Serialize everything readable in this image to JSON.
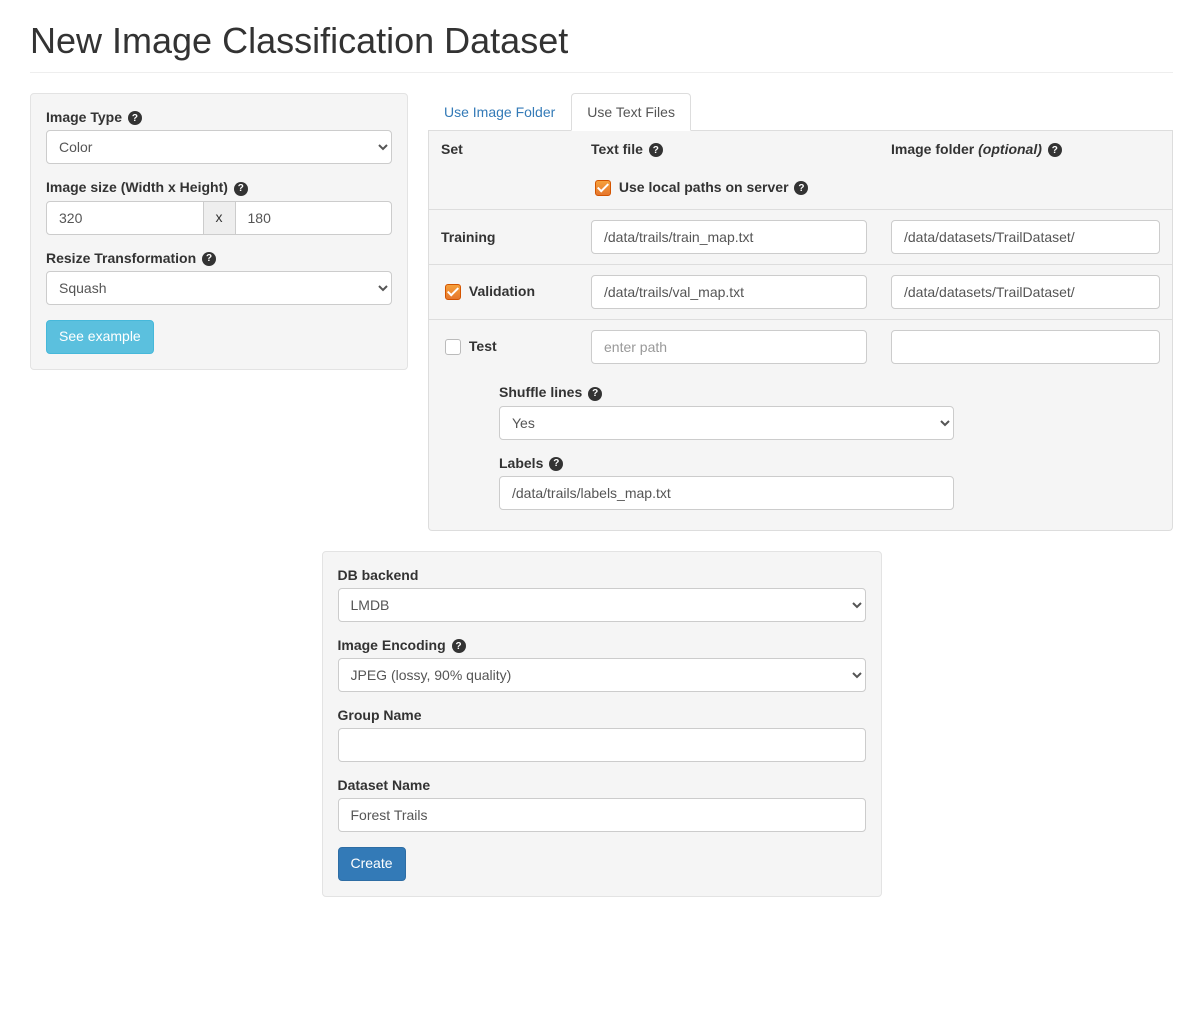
{
  "page": {
    "title": "New Image Classification Dataset"
  },
  "left": {
    "imageTypeLabel": "Image Type",
    "imageTypeValue": "Color",
    "imageSizeLabel": "Image size (Width x Height)",
    "width": "320",
    "height": "180",
    "xLabel": "x",
    "resizeLabel": "Resize Transformation",
    "resizeValue": "Squash",
    "seeExample": "See example"
  },
  "tabs": {
    "folder": "Use Image Folder",
    "text": "Use Text Files"
  },
  "setTable": {
    "colSet": "Set",
    "colTextFile": "Text file",
    "colImageFolder": "Image folder",
    "colOptional": "(optional)",
    "useLocal": "Use local paths on server",
    "training": {
      "label": "Training",
      "textfile": "/data/trails/train_map.txt",
      "folder": "/data/datasets/TrailDataset/"
    },
    "validation": {
      "label": "Validation",
      "textfile": "/data/trails/val_map.txt",
      "folder": "/data/datasets/TrailDataset/"
    },
    "test": {
      "label": "Test",
      "textfile": "",
      "placeholder": "enter path",
      "folder": ""
    },
    "shuffleLabel": "Shuffle lines",
    "shuffleValue": "Yes",
    "labelsLabel": "Labels",
    "labelsValue": "/data/trails/labels_map.txt"
  },
  "bottom": {
    "dbBackendLabel": "DB backend",
    "dbBackendValue": "LMDB",
    "imageEncodingLabel": "Image Encoding",
    "imageEncodingValue": "JPEG (lossy, 90% quality)",
    "groupNameLabel": "Group Name",
    "groupNameValue": "",
    "datasetNameLabel": "Dataset Name",
    "datasetNameValue": "Forest Trails",
    "createLabel": "Create"
  }
}
